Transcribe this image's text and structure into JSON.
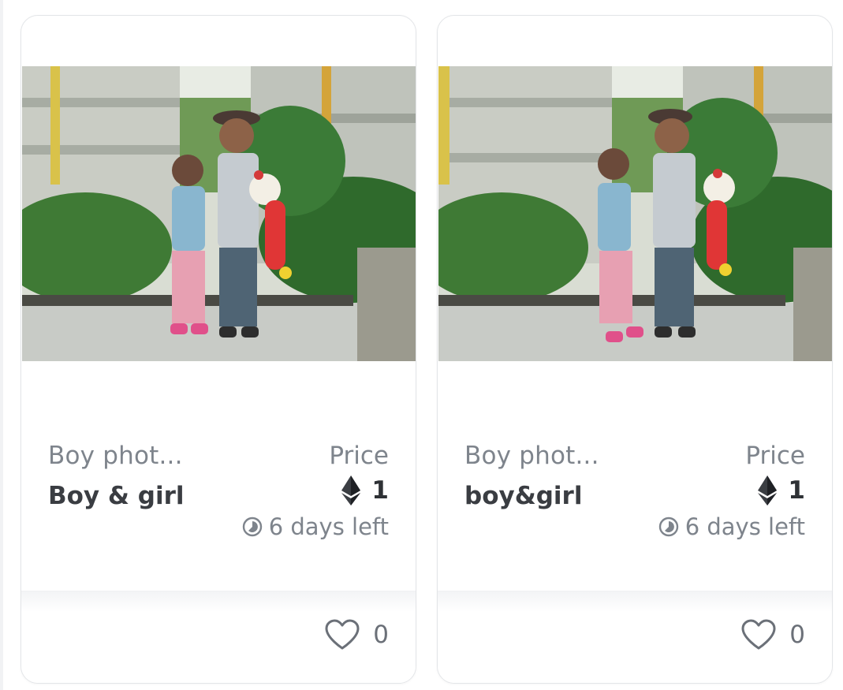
{
  "cards": [
    {
      "collection": "Boy phot...",
      "title": "Boy & girl",
      "price_label": "Price",
      "price_value": "1",
      "currency_icon": "ethereum-icon",
      "time_left": "6 days left",
      "time_icon": "clock-icon",
      "likes": "0",
      "like_icon": "heart-outline-icon"
    },
    {
      "collection": "Boy phot...",
      "title": "boy&girl",
      "price_label": "Price",
      "price_value": "1",
      "currency_icon": "ethereum-icon",
      "time_left": "6 days left",
      "time_icon": "clock-icon",
      "likes": "0",
      "like_icon": "heart-outline-icon"
    }
  ],
  "colors": {
    "text_muted": "#7e848c",
    "text_dark": "#3a3d42",
    "card_border": "#e3e5e8"
  }
}
